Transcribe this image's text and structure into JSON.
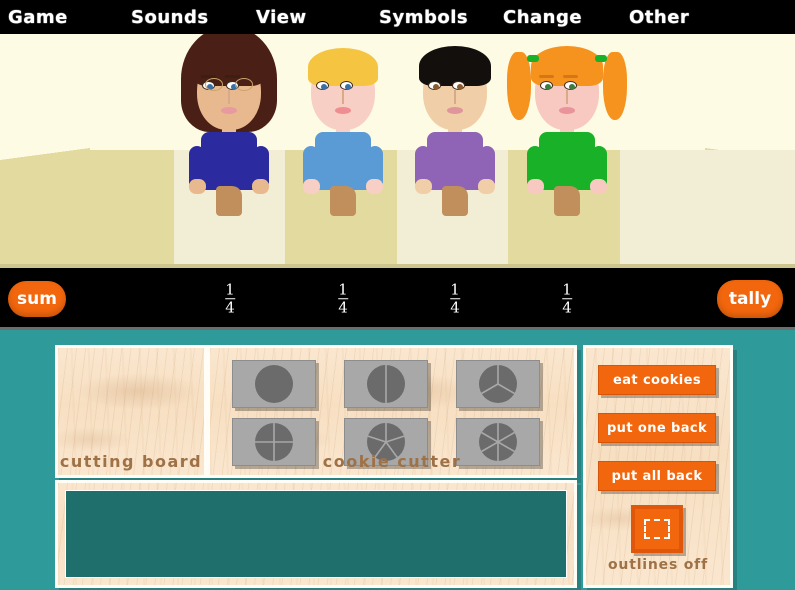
{
  "menu": {
    "items": [
      {
        "label": "Game"
      },
      {
        "label": "Sounds"
      },
      {
        "label": "View"
      },
      {
        "label": "Symbols"
      },
      {
        "label": "Change"
      },
      {
        "label": "Other"
      }
    ]
  },
  "scene": {
    "characters": [
      {
        "name": "character-1",
        "hair_color": "#4a1f16",
        "hair_style": "long-brown",
        "skin_color": "#e8b98e",
        "shirt_color": "#2b2a9e",
        "eye_color": "#3a6ea5",
        "has_glasses": true,
        "has_cookie": true
      },
      {
        "name": "character-2",
        "hair_color": "#f5c542",
        "hair_style": "short-blonde",
        "skin_color": "#f7cfc4",
        "shirt_color": "#5b9bd5",
        "eye_color": "#3a6ea5",
        "has_glasses": false,
        "has_cookie": true
      },
      {
        "name": "character-3",
        "hair_color": "#120f0d",
        "hair_style": "short-black",
        "skin_color": "#f0cfa8",
        "shirt_color": "#8f63b5",
        "eye_color": "#8a5a2b",
        "has_glasses": false,
        "has_cookie": true
      },
      {
        "name": "character-4",
        "hair_color": "#f6931e",
        "hair_style": "orange-pigtails",
        "skin_color": "#f7c9c0",
        "shirt_color": "#19b128",
        "eye_color": "#3f7a3f",
        "has_glasses": false,
        "has_cookie": true,
        "hair_tie_color": "#19b128"
      }
    ],
    "table_color": "#e3da9f",
    "placemat_color": "#f2eed5",
    "wall_color": "#fdfbe4"
  },
  "fraction_bar": {
    "sum_label": "sum",
    "tally_label": "tally",
    "fractions": [
      {
        "numerator": "1",
        "denominator": "4"
      },
      {
        "numerator": "1",
        "denominator": "4"
      },
      {
        "numerator": "1",
        "denominator": "4"
      },
      {
        "numerator": "1",
        "denominator": "4"
      }
    ],
    "background": "#000000",
    "button_color": "#f2660d"
  },
  "workspace": {
    "cutting_board_label": "cutting board",
    "cookie_cutter_label": "cookie cutter",
    "cutters": [
      {
        "name": "cutter-1-slice",
        "slices": 1
      },
      {
        "name": "cutter-2-slices",
        "slices": 2
      },
      {
        "name": "cutter-3-slices",
        "slices": 3
      },
      {
        "name": "cutter-4-slices",
        "slices": 4
      },
      {
        "name": "cutter-5-slices",
        "slices": 5
      },
      {
        "name": "cutter-6-slices",
        "slices": 6
      }
    ],
    "actions": [
      {
        "label": "eat cookies"
      },
      {
        "label": "put one back"
      },
      {
        "label": "put all back"
      }
    ],
    "outlines_toggle_label": "outlines off",
    "chalkboard_color": "#1f6f6c",
    "wood_color": "#fae7cf",
    "cutter_face_color": "#a8a8a8",
    "cutter_cookie_color": "#6b6b6b",
    "background_color": "#2f9a9a"
  }
}
